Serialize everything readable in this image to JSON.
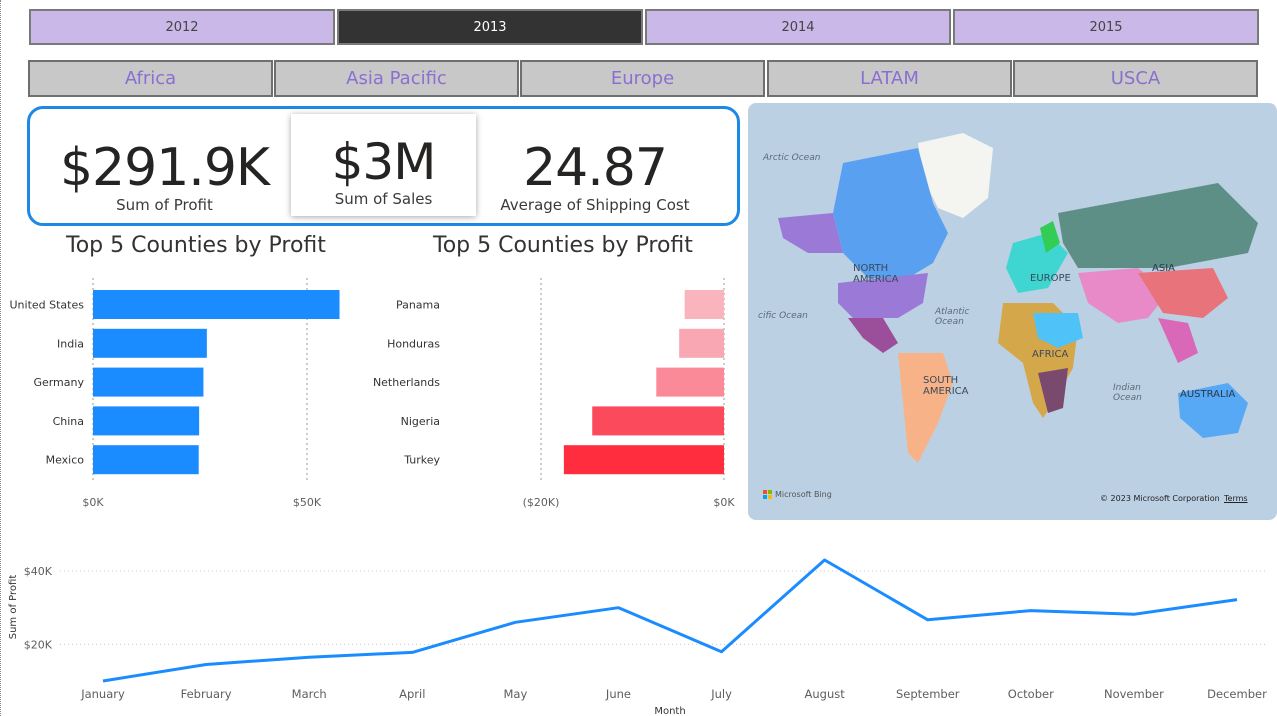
{
  "years": [
    {
      "label": "2012",
      "active": false
    },
    {
      "label": "2013",
      "active": true
    },
    {
      "label": "2014",
      "active": false
    },
    {
      "label": "2015",
      "active": false
    }
  ],
  "regions": [
    "Africa",
    "Asia Pacific",
    "Europe",
    "LATAM",
    "USCA"
  ],
  "kpis": {
    "profit": {
      "value": "$291.9K",
      "label": "Sum of Profit"
    },
    "sales": {
      "value": "$3M",
      "label": "Sum of Sales"
    },
    "shipping": {
      "value": "24.87",
      "label": "Average of Shipping Cost"
    }
  },
  "colors": {
    "accent": "#1e88e5",
    "bar_blue": "#1a8cff",
    "neg_red": "#ff2d3d"
  },
  "chart_data": [
    {
      "type": "bar",
      "orientation": "horizontal",
      "title": "Top 5 Counties by Profit",
      "categories": [
        "United States",
        "India",
        "Germany",
        "China",
        "Mexico"
      ],
      "values": [
        57600,
        26600,
        25800,
        24800,
        24700
      ],
      "xlim": [
        0,
        60000
      ],
      "ticks": [
        "$0K",
        "$50K"
      ],
      "tick_values": [
        0,
        50000
      ],
      "grid": true
    },
    {
      "type": "bar",
      "orientation": "horizontal",
      "title": "Top 5 Counties by Profit",
      "categories": [
        "Panama",
        "Honduras",
        "Netherlands",
        "Nigeria",
        "Turkey"
      ],
      "values": [
        -4300,
        -4900,
        -7400,
        -14400,
        -17500
      ],
      "colors": [
        "#f9b4be",
        "#f9a7b2",
        "#fb8a98",
        "#fc4a5d",
        "#ff2d3d"
      ],
      "xlim": [
        -20000,
        0
      ],
      "ticks": [
        "($20K)",
        "$0K"
      ],
      "tick_values": [
        -20000,
        0
      ],
      "grid": true
    },
    {
      "type": "line",
      "xlabel": "Month",
      "ylabel": "Sum of Profit",
      "x": [
        "January",
        "February",
        "March",
        "April",
        "May",
        "June",
        "July",
        "August",
        "September",
        "October",
        "November",
        "December"
      ],
      "values": [
        10000,
        14500,
        16500,
        17800,
        26000,
        30000,
        18000,
        43000,
        26700,
        29200,
        28200,
        32200
      ],
      "ylim": [
        10000,
        45000
      ],
      "ticks": [
        "$20K",
        "$40K"
      ],
      "tick_values": [
        20000,
        40000
      ],
      "grid": true
    }
  ],
  "map": {
    "labels": {
      "arctic": "Arctic Ocean",
      "north_america": "NORTH AMERICA",
      "europe": "EUROPE",
      "asia": "ASIA",
      "atlantic": "Atlantic Ocean",
      "pacific": "cific Ocean",
      "africa": "AFRICA",
      "south_america": "SOUTH AMERICA",
      "indian": "Indian Ocean",
      "australia": "AUSTRALIA"
    },
    "attribution": "© 2023 Microsoft Corporation",
    "terms": "Terms",
    "brand": "Microsoft Bing"
  }
}
